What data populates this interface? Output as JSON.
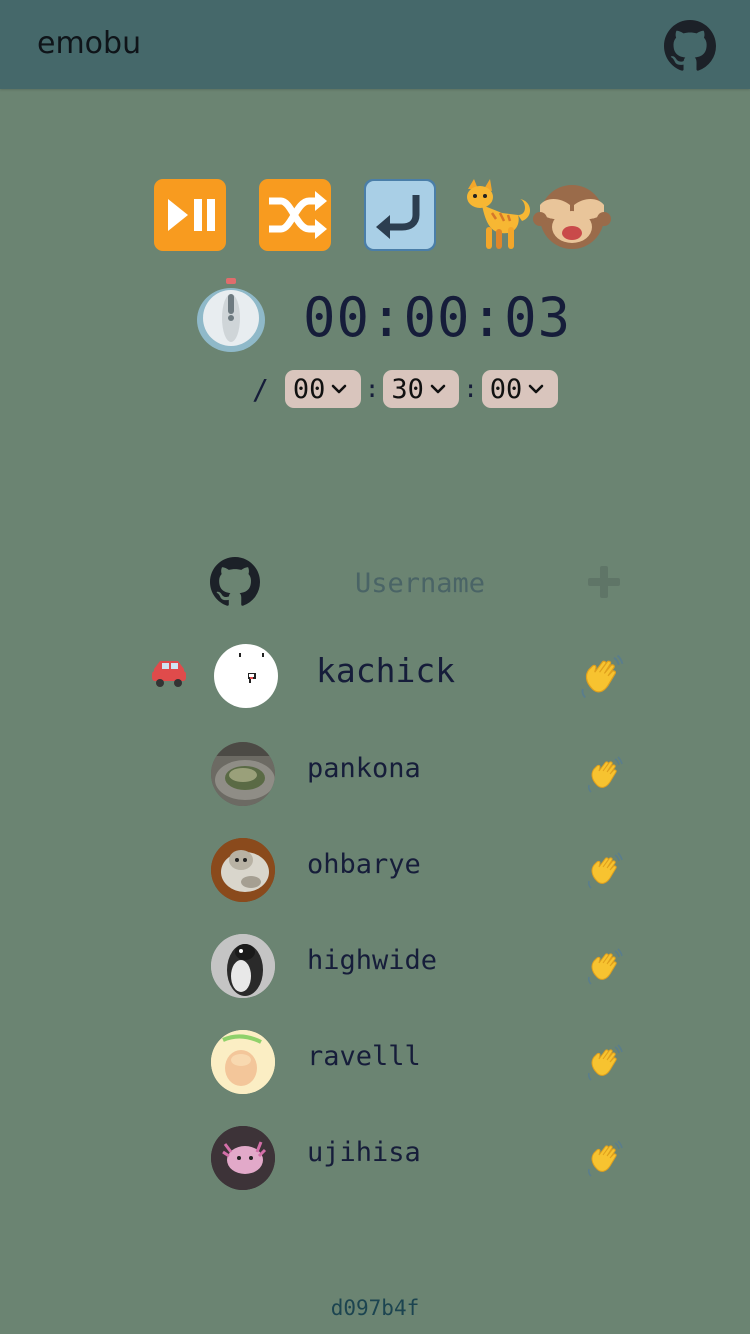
{
  "app": {
    "title": "emobu"
  },
  "header": {
    "github_icon": "github-icon"
  },
  "controls": [
    {
      "name": "play-pause-button",
      "icon": "play-pause-icon"
    },
    {
      "name": "shuffle-button",
      "icon": "shuffle-icon"
    },
    {
      "name": "rotate-back-button",
      "icon": "return-arrow-icon"
    },
    {
      "name": "cat-button",
      "icon": "cat-icon"
    },
    {
      "name": "see-no-evil-button",
      "icon": "see-no-evil-monkey-icon"
    }
  ],
  "timer": {
    "icon": "stopwatch-icon",
    "elapsed": "00:00:03",
    "separator": "/",
    "limit": {
      "hours": "00",
      "minutes": "30",
      "seconds": "00"
    },
    "colon": ":"
  },
  "add_user": {
    "placeholder": "Username",
    "github_icon": "github-icon",
    "add_icon": "plus-icon"
  },
  "members": [
    {
      "name": "kachick",
      "driver": true,
      "avatar": "avatar-kachick"
    },
    {
      "name": "pankona",
      "driver": false,
      "avatar": "avatar-pankona"
    },
    {
      "name": "ohbarye",
      "driver": false,
      "avatar": "avatar-ohbarye"
    },
    {
      "name": "highwide",
      "driver": false,
      "avatar": "avatar-highwide"
    },
    {
      "name": "ravelll",
      "driver": false,
      "avatar": "avatar-ravelll"
    },
    {
      "name": "ujihisa",
      "driver": false,
      "avatar": "avatar-ujihisa"
    }
  ],
  "footer": {
    "version": "d097b4f"
  },
  "colors": {
    "background": "#6b8472",
    "header": "#45686a",
    "text": "#161d3a",
    "select_bg": "#d9c5bd"
  }
}
